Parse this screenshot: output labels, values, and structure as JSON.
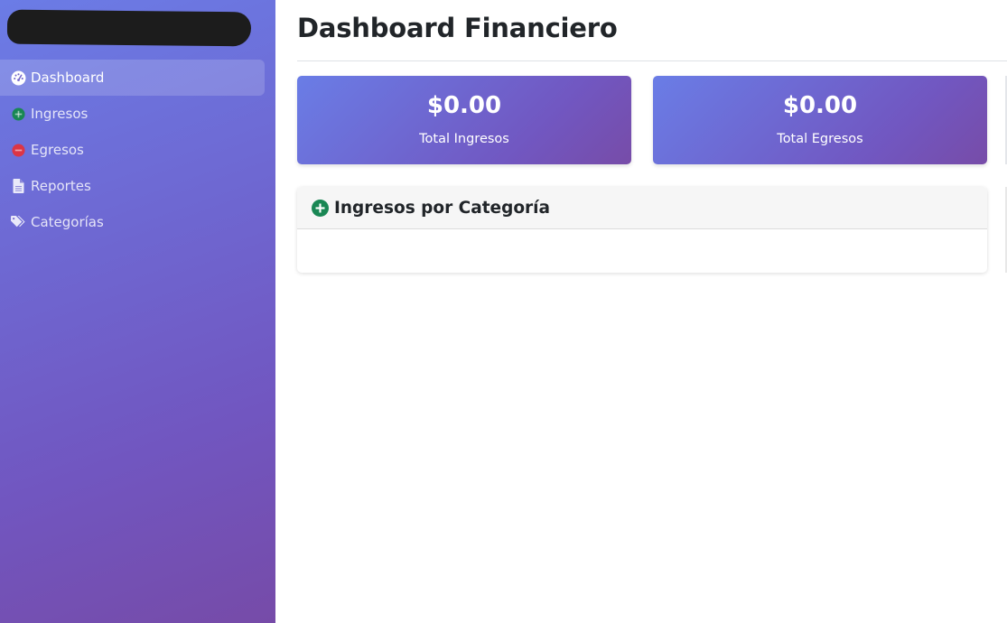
{
  "sidebar": {
    "items": [
      {
        "label": "Dashboard",
        "icon": "tachometer-icon",
        "active": true
      },
      {
        "label": "Ingresos",
        "icon": "plus-circle-icon",
        "active": false
      },
      {
        "label": "Egresos",
        "icon": "minus-circle-icon",
        "active": false
      },
      {
        "label": "Reportes",
        "icon": "file-icon",
        "active": false
      },
      {
        "label": "Categorías",
        "icon": "tags-icon",
        "active": false
      }
    ]
  },
  "main": {
    "title": "Dashboard Financiero",
    "stats": [
      {
        "value": "$0.00",
        "label": "Total Ingresos"
      },
      {
        "value": "$0.00",
        "label": "Total Egresos"
      }
    ],
    "panel": {
      "title": "Ingresos por Categoría",
      "icon": "plus-circle-icon"
    }
  },
  "colors": {
    "gradient_start": "#6a7de6",
    "gradient_end": "#764ba8",
    "success": "#198754",
    "danger": "#dc3545"
  }
}
